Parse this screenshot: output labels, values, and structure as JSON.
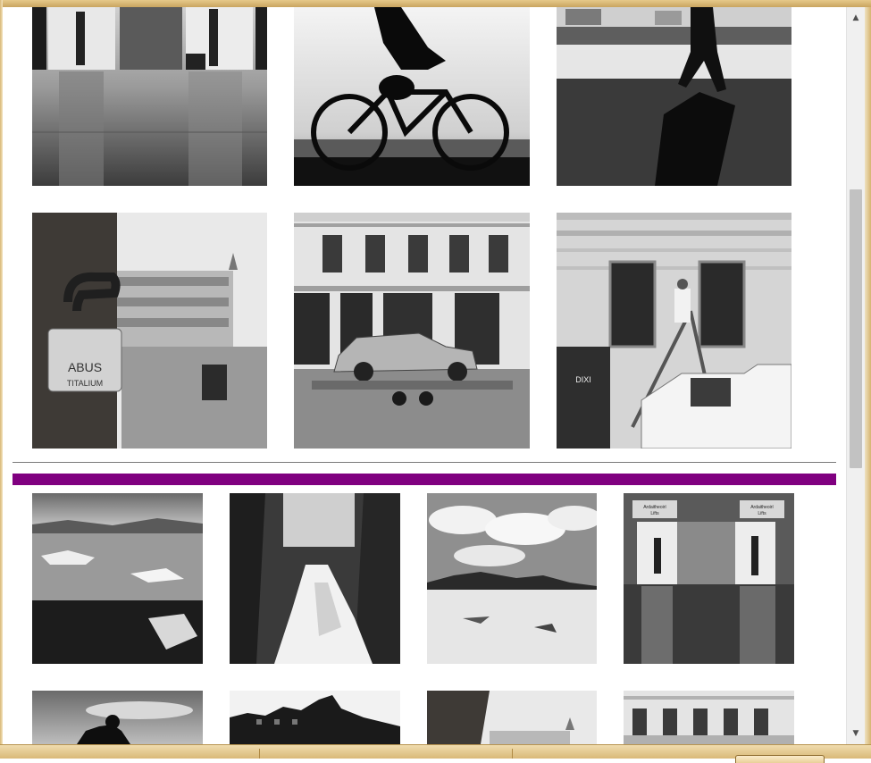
{
  "gallery": {
    "upper_rows": [
      [
        {
          "subject": "elevator-reflection"
        },
        {
          "subject": "cyclist-silhouette"
        },
        {
          "subject": "walker-shadow"
        }
      ],
      [
        {
          "subject": "padlock-square",
          "lock_text": "ABUS",
          "lock_subtext": "TITALIUM"
        },
        {
          "subject": "car-on-trailer"
        },
        {
          "subject": "painter-ladder",
          "toilet_text": "DIXI"
        }
      ]
    ],
    "lower_rows": [
      [
        {
          "subject": "ice-lagoon"
        },
        {
          "subject": "forest-waterfall"
        },
        {
          "subject": "desert-clouds"
        },
        {
          "subject": "elevator-doors",
          "sign_left": "Ardaitheoirí",
          "sign_left_sub": "Lifts",
          "sign_right": "Ardaitheoirí",
          "sign_right_sub": "Lifts"
        }
      ],
      [
        {
          "subject": "cyclist-sky"
        },
        {
          "subject": "building-silhouette"
        },
        {
          "subject": "padlock-square"
        },
        {
          "subject": "building-facade"
        }
      ]
    ]
  },
  "section_bar_color": "#800080",
  "scrollbar": {
    "up_icon": "arrow-up-icon",
    "down_icon": "arrow-down-icon",
    "up_glyph": "▲",
    "down_glyph": "▼"
  }
}
